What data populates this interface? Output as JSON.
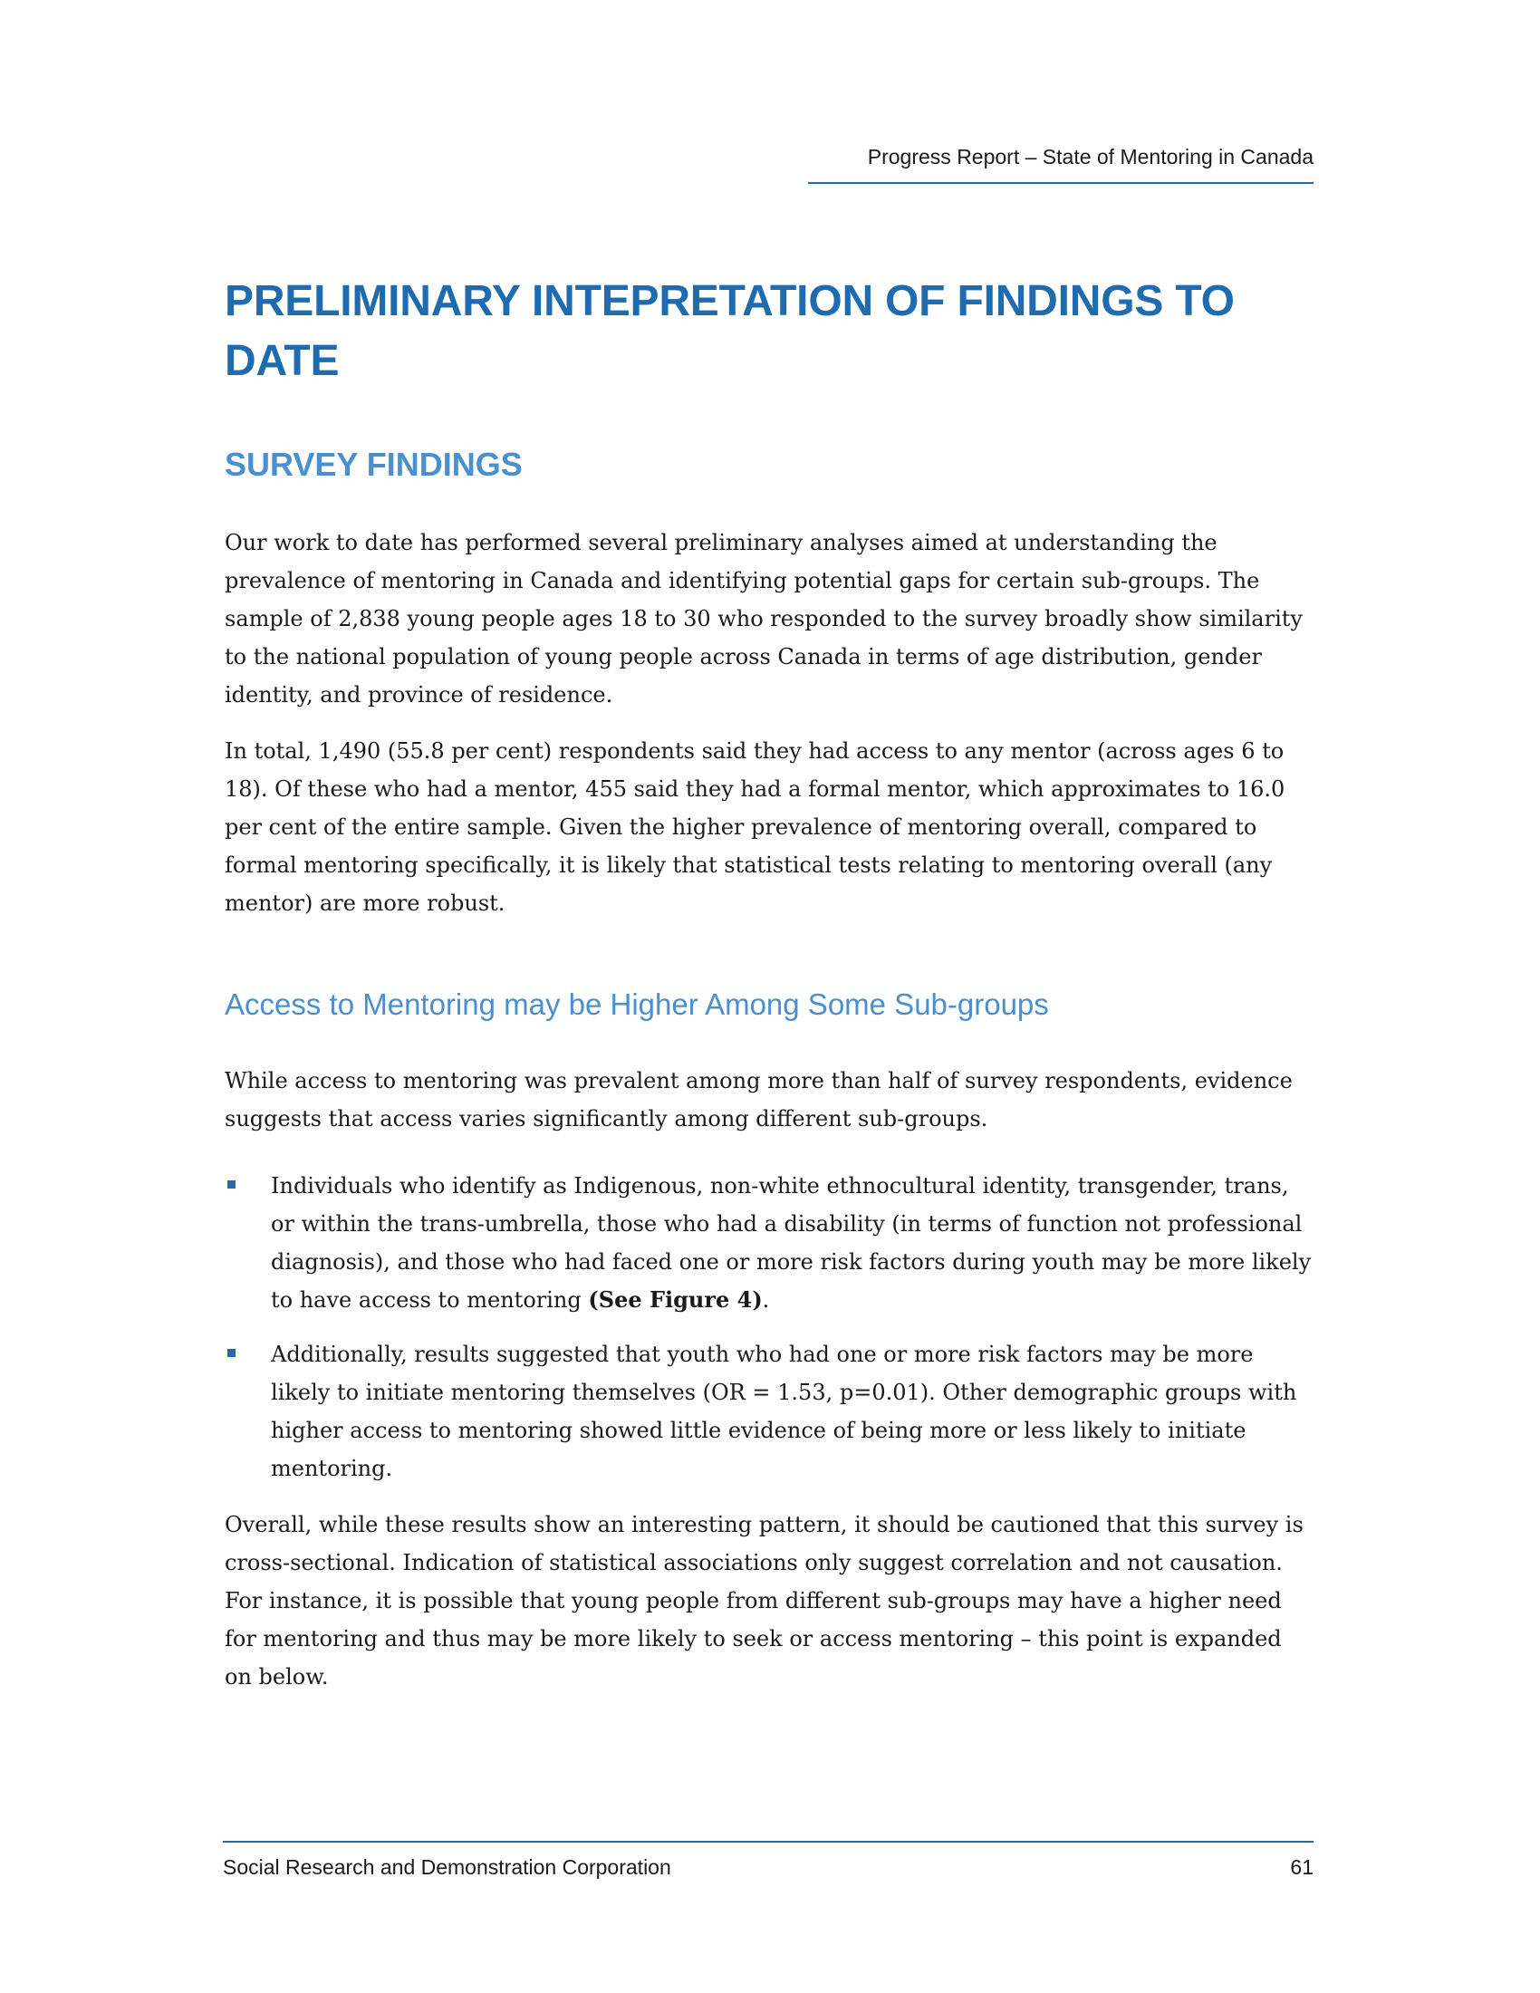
{
  "header": {
    "running_title": "Progress Report – State of Mentoring in Canada"
  },
  "section": {
    "title": "PRELIMINARY INTEPRETATION OF FINDINGS TO DATE",
    "subtitle": "SURVEY FINDINGS",
    "paragraphs": [
      "Our work to date has performed several preliminary analyses aimed at understanding the prevalence of mentoring in Canada and identifying potential gaps for certain sub-groups. The sample of 2,838 young people ages 18 to 30 who responded to the survey broadly show similarity to the national population of young people across Canada in terms of age distribution, gender identity, and province of residence.",
      "In total, 1,490 (55.8 per cent) respondents said they had access to any mentor (across ages 6 to 18). Of these who had a mentor, 455 said they had a formal mentor, which approximates to 16.0 per cent of the entire sample. Given the higher prevalence of mentoring overall, compared to formal mentoring specifically, it is likely that statistical tests relating to mentoring overall (any mentor) are more robust."
    ],
    "subsection": {
      "title": "Access to Mentoring may be Higher Among Some Sub-groups",
      "intro": "While access to mentoring was prevalent among more than half of survey respondents, evidence suggests that access varies significantly among different sub-groups.",
      "bullets": [
        {
          "text": "Individuals who identify as Indigenous, non-white ethnocultural identity, transgender, trans, or within the trans-umbrella, those who had a disability (in terms of function not professional diagnosis), and those who had faced one or more risk factors during youth may be more likely to have access to mentoring ",
          "bold": "(See Figure 4)",
          "tail": "."
        },
        {
          "text": "Additionally, results suggested that youth who had one or more risk factors may be more likely to initiate mentoring themselves (OR = 1.53, p=0.01). Other demographic groups with higher access to mentoring showed little evidence of being more or less likely to initiate mentoring."
        }
      ],
      "closing": "Overall, while these results show an interesting pattern, it should be cautioned that this survey is cross-sectional. Indication of statistical associations only suggest correlation and not causation. For instance, it is possible that young people from different sub-groups may have a higher need for mentoring and thus may be more likely to seek or access mentoring – this point is expanded on below."
    }
  },
  "footer": {
    "organization": "Social Research and Demonstration Corporation",
    "page_number": "61"
  },
  "colors": {
    "heading_blue": "#1f6bb0",
    "subheading_blue": "#4a8fd0",
    "rule_blue": "#1f6bb0"
  }
}
